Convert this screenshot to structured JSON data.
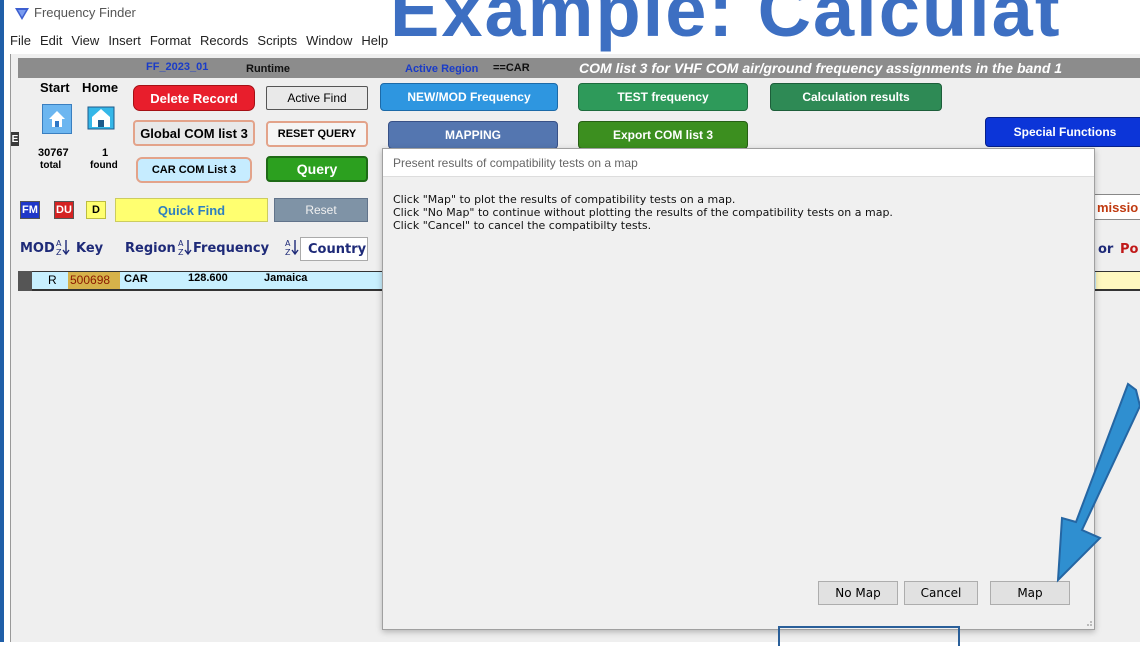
{
  "window": {
    "title": "Frequency Finder",
    "banner": "Example: Calculat"
  },
  "menu": [
    "File",
    "Edit",
    "View",
    "Insert",
    "Format",
    "Records",
    "Scripts",
    "Window",
    "Help"
  ],
  "header": {
    "file_name": "FF_2023_01",
    "mode": "Runtime",
    "active_region_label": "Active Region",
    "active_region_value": "==CAR",
    "list_title": "COM list 3 for VHF COM air/ground frequency assignments in the band 1"
  },
  "nav": {
    "start": "Start",
    "home": "Home",
    "e_label": "E"
  },
  "counts": {
    "total_value": "30767",
    "total_label": "total",
    "found_value": "1",
    "found_label": "found"
  },
  "buttons": {
    "delete_record": "Delete Record",
    "active_find": "Active Find",
    "new_mod_frequency": "NEW/MOD Frequency",
    "test_frequency": "TEST frequency",
    "calculation_results": "Calculation results",
    "global_com_list": "Global COM list 3",
    "reset_query": "RESET QUERY",
    "mapping": "MAPPING",
    "export_com_list": "Export COM list 3",
    "special_functions": "Special Functions",
    "car_com_list": "CAR COM List 3",
    "query": "Query",
    "quick_find": "Quick Find",
    "reset": "Reset",
    "fm": "FM",
    "du": "DU",
    "d": "D",
    "mission_partial": "missio"
  },
  "columns": {
    "mod": "MOD",
    "key": "Key",
    "region": "Region",
    "frequency": "Frequency",
    "country": "Country",
    "or_partial": "or",
    "po_partial": "Po"
  },
  "record": {
    "mod": "R",
    "key": "500698",
    "region": "CAR",
    "frequency": "128.600",
    "country": "Jamaica"
  },
  "dialog": {
    "title": "Present results of compatibility tests on a map",
    "lines": [
      "Click \"Map\" to plot the results of compatibility tests on a map.",
      "Click \"No Map\" to continue without plotting the results of the compatibility tests on a map.",
      "Click \"Cancel\" to cancel the compatibilty tests."
    ],
    "no_map": "No Map",
    "cancel": "Cancel",
    "map": "Map"
  },
  "colors": {
    "arrow": "#2f8fd0",
    "banner": "#3d6fc2",
    "accent_blue": "#1f5fa8"
  },
  "icons": [
    "app-icon",
    "home-icon",
    "browser-icon",
    "sort-az-icon",
    "arrow-annotation-icon"
  ]
}
